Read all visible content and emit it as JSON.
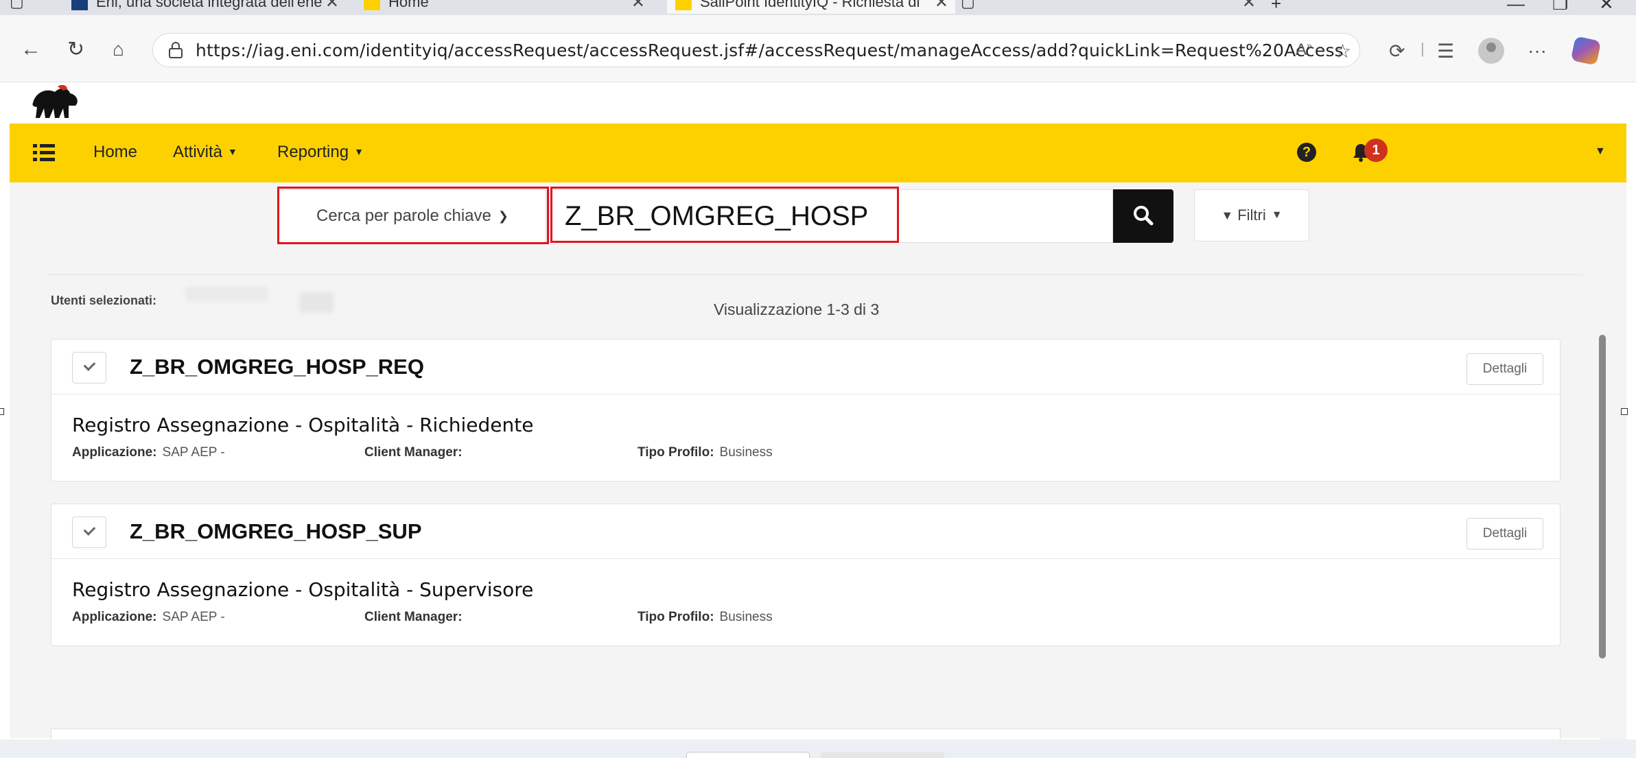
{
  "browser": {
    "tabs": [
      {
        "title": "Eni, una società integrata dell'ene"
      },
      {
        "title": "Home"
      },
      {
        "title": "SailPoint IdentityIQ - Richiesta di"
      },
      {
        "title": ""
      }
    ],
    "url": "https://iag.eni.com/identityiq/accessRequest/accessRequest.jsf#/accessRequest/manageAccess/add?quickLink=Request%20Access",
    "icons": [
      "back-icon",
      "refresh-icon",
      "home-icon",
      "lock-icon",
      "read-aloud-icon",
      "favorite-icon",
      "extensions-icon",
      "collections-icon",
      "profile-icon",
      "more-icon",
      "copilot-icon"
    ]
  },
  "navbar": {
    "home": "Home",
    "attivita": "Attività",
    "reporting": "Reporting",
    "notification_count": "1",
    "accent_color": "#fdd100"
  },
  "search": {
    "mode_label": "Cerca per parole chiave",
    "query": "Z_BR_OMGREG_HOSP",
    "filters_label": "Filtri"
  },
  "results": {
    "selected_users_label": "Utenti selezionati:",
    "count_label": "Visualizzazione 1-3 di 3",
    "items": [
      {
        "title": "Z_BR_OMGREG_HOSP_REQ",
        "details_label": "Dettagli",
        "description": "Registro Assegnazione - Ospitalità - Richiedente",
        "app_label": "Applicazione:",
        "app_value": "SAP AEP -",
        "client_label": "Client Manager:",
        "client_value": "",
        "profile_label": "Tipo Profilo:",
        "profile_value": "Business"
      },
      {
        "title": "Z_BR_OMGREG_HOSP_SUP",
        "details_label": "Dettagli",
        "description": "Registro Assegnazione - Ospitalità - Supervisore",
        "app_label": "Applicazione:",
        "app_value": "SAP AEP -",
        "client_label": "Client Manager:",
        "client_value": "",
        "profile_label": "Tipo Profilo:",
        "profile_value": "Business"
      }
    ]
  }
}
